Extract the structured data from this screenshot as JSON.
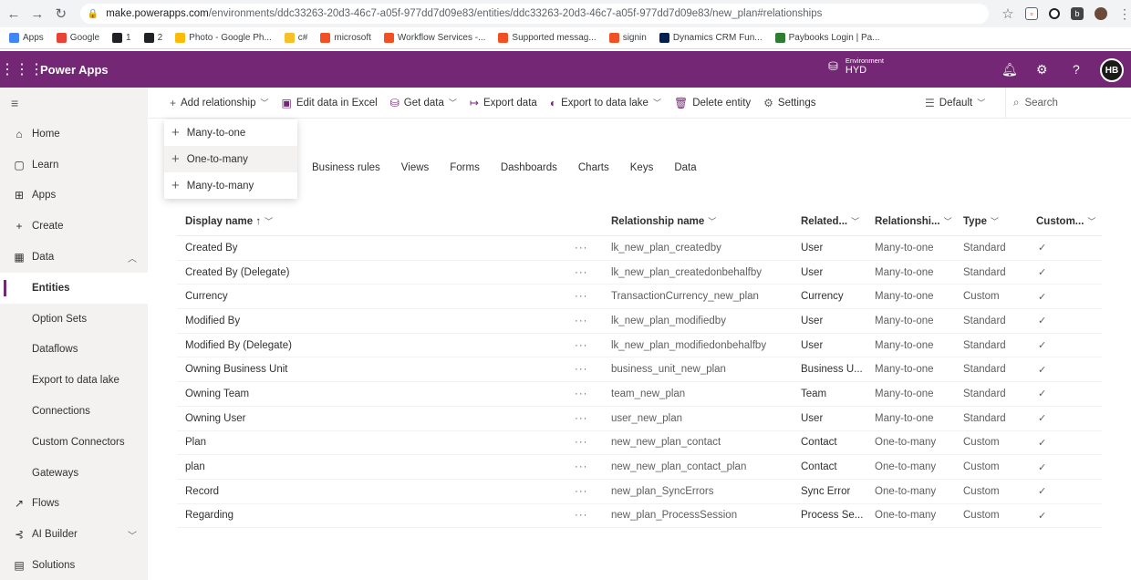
{
  "browser": {
    "url_host": "make.powerapps.com",
    "url_path": "/environments/ddc33263-20d3-46c7-a05f-977dd7d09e83/entities/ddc33263-20d3-46c7-a05f-977dd7d09e83/new_plan#relationships",
    "bookmarks": [
      {
        "label": "Apps",
        "color": "#4285f4"
      },
      {
        "label": "Google",
        "color": "#ea4335"
      },
      {
        "label": "1",
        "color": "#202124"
      },
      {
        "label": "2",
        "color": "#202124"
      },
      {
        "label": "Photo - Google Ph...",
        "color": "#fbbc05"
      },
      {
        "label": "c#",
        "color": "#f6c026"
      },
      {
        "label": "microsoft",
        "color": "#f25022"
      },
      {
        "label": "Workflow Services -...",
        "color": "#f25022"
      },
      {
        "label": "Supported messag...",
        "color": "#f25022"
      },
      {
        "label": "signin",
        "color": "#f25022"
      },
      {
        "label": "Dynamics CRM Fun...",
        "color": "#002050"
      },
      {
        "label": "Paybooks Login | Pa...",
        "color": "#2e7d32"
      }
    ]
  },
  "header": {
    "app_title": "Power Apps",
    "env_label": "Environment",
    "env_name": "HYD",
    "avatar": "HB",
    "accent": "#742774"
  },
  "sidebar": {
    "items": [
      {
        "label": "Home",
        "icon": "⌂"
      },
      {
        "label": "Learn",
        "icon": "▢"
      },
      {
        "label": "Apps",
        "icon": "⊞"
      },
      {
        "label": "Create",
        "icon": "+"
      },
      {
        "label": "Data",
        "icon": "▦",
        "chev": "︿"
      },
      {
        "label": "Entities",
        "sub": true,
        "active": true
      },
      {
        "label": "Option Sets",
        "sub": true
      },
      {
        "label": "Dataflows",
        "sub": true
      },
      {
        "label": "Export to data lake",
        "sub": true
      },
      {
        "label": "Connections",
        "sub": true
      },
      {
        "label": "Custom Connectors",
        "sub": true
      },
      {
        "label": "Gateways",
        "sub": true
      },
      {
        "label": "Flows",
        "icon": "↗"
      },
      {
        "label": "AI Builder",
        "icon": "⊰",
        "chev": "﹀"
      },
      {
        "label": "Solutions",
        "icon": "▤"
      }
    ]
  },
  "commands": {
    "add_relationship": "Add relationship",
    "edit_excel": "Edit data in Excel",
    "get_data": "Get data",
    "export_data": "Export data",
    "export_lake": "Export to data lake",
    "delete_entity": "Delete entity",
    "settings": "Settings",
    "view": "Default",
    "search": "Search"
  },
  "dropdown": [
    "Many-to-one",
    "One-to-many",
    "Many-to-many"
  ],
  "tabs": [
    "Business rules",
    "Views",
    "Forms",
    "Dashboards",
    "Charts",
    "Keys",
    "Data"
  ],
  "table": {
    "headers": {
      "display_name": "Display name ↑",
      "relationship_name": "Relationship name",
      "related": "Related...",
      "relationship_type": "Relationshi...",
      "type": "Type",
      "custom": "Custom..."
    },
    "rows": [
      {
        "display": "Created By",
        "rel": "lk_new_plan_createdby",
        "related": "User",
        "rtype": "Many-to-one",
        "type": "Standard"
      },
      {
        "display": "Created By (Delegate)",
        "rel": "lk_new_plan_createdonbehalfby",
        "related": "User",
        "rtype": "Many-to-one",
        "type": "Standard"
      },
      {
        "display": "Currency",
        "rel": "TransactionCurrency_new_plan",
        "related": "Currency",
        "rtype": "Many-to-one",
        "type": "Custom"
      },
      {
        "display": "Modified By",
        "rel": "lk_new_plan_modifiedby",
        "related": "User",
        "rtype": "Many-to-one",
        "type": "Standard"
      },
      {
        "display": "Modified By (Delegate)",
        "rel": "lk_new_plan_modifiedonbehalfby",
        "related": "User",
        "rtype": "Many-to-one",
        "type": "Standard"
      },
      {
        "display": "Owning Business Unit",
        "rel": "business_unit_new_plan",
        "related": "Business U...",
        "rtype": "Many-to-one",
        "type": "Standard"
      },
      {
        "display": "Owning Team",
        "rel": "team_new_plan",
        "related": "Team",
        "rtype": "Many-to-one",
        "type": "Standard"
      },
      {
        "display": "Owning User",
        "rel": "user_new_plan",
        "related": "User",
        "rtype": "Many-to-one",
        "type": "Standard"
      },
      {
        "display": "Plan",
        "rel": "new_new_plan_contact",
        "related": "Contact",
        "rtype": "One-to-many",
        "type": "Custom"
      },
      {
        "display": "plan",
        "rel": "new_new_plan_contact_plan",
        "related": "Contact",
        "rtype": "One-to-many",
        "type": "Custom"
      },
      {
        "display": "Record",
        "rel": "new_plan_SyncErrors",
        "related": "Sync Error",
        "rtype": "One-to-many",
        "type": "Custom"
      },
      {
        "display": "Regarding",
        "rel": "new_plan_ProcessSession",
        "related": "Process Se...",
        "rtype": "One-to-many",
        "type": "Custom"
      }
    ]
  }
}
